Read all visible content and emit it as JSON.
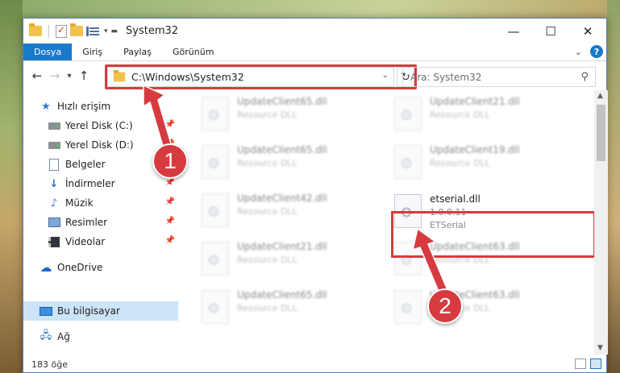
{
  "window": {
    "title": "System32",
    "controls": {
      "minimize": "—",
      "maximize": "☐",
      "close": "✕"
    }
  },
  "ribbon": {
    "tabs": [
      "Dosya",
      "Giriş",
      "Paylaş",
      "Görünüm"
    ],
    "help": "?"
  },
  "address": {
    "path": "C:\\Windows\\System32",
    "search_placeholder": "Ara: System32"
  },
  "sidebar": {
    "items": [
      {
        "label": "Hızlı erişim",
        "icon": "star-icon"
      },
      {
        "label": "Yerel Disk (C:)",
        "icon": "drive-icon",
        "pinned": true
      },
      {
        "label": "Yerel Disk (D:)",
        "icon": "drive-icon",
        "pinned": true
      },
      {
        "label": "Belgeler",
        "icon": "documents-icon",
        "pinned": true
      },
      {
        "label": "İndirmeler",
        "icon": "download-icon",
        "pinned": true
      },
      {
        "label": "Müzik",
        "icon": "music-icon",
        "pinned": true
      },
      {
        "label": "Resimler",
        "icon": "pictures-icon",
        "pinned": true
      },
      {
        "label": "Videolar",
        "icon": "videos-icon",
        "pinned": true
      },
      {
        "label": "OneDrive",
        "icon": "cloud-icon"
      },
      {
        "label": "Bu bilgisayar",
        "icon": "computer-icon",
        "selected": true
      },
      {
        "label": "Ağ",
        "icon": "network-icon"
      }
    ]
  },
  "files": {
    "left_column": [
      {
        "name": "UpdateClient65.dll",
        "type": "Resource DLL"
      },
      {
        "name": "UpdateClient65.dll",
        "type": "Resource DLL"
      },
      {
        "name": "UpdateClient42.dll",
        "type": "Resource DLL"
      },
      {
        "name": "UpdateClient21.dll",
        "type": "Resource DLL"
      },
      {
        "name": "UpdateClient65.dll",
        "type": "Resource DLL"
      }
    ],
    "right_column": [
      {
        "name": "UpdateClient21.dll",
        "type": "Resource DLL"
      },
      {
        "name": "UpdateClient19.dll",
        "type": "Resource DLL"
      },
      {
        "name": "etserial.dll",
        "version": "1.0.0.11",
        "type": "ETSerial"
      },
      {
        "name": "UpdateClient63.dll",
        "type": "Resource DLL"
      },
      {
        "name": "UpdateClient63.dll",
        "type": "Resource DLL"
      }
    ]
  },
  "status": {
    "item_count": "183 öğe"
  },
  "annotations": {
    "badge1": "1",
    "badge2": "2",
    "color": "#d63b3f"
  }
}
